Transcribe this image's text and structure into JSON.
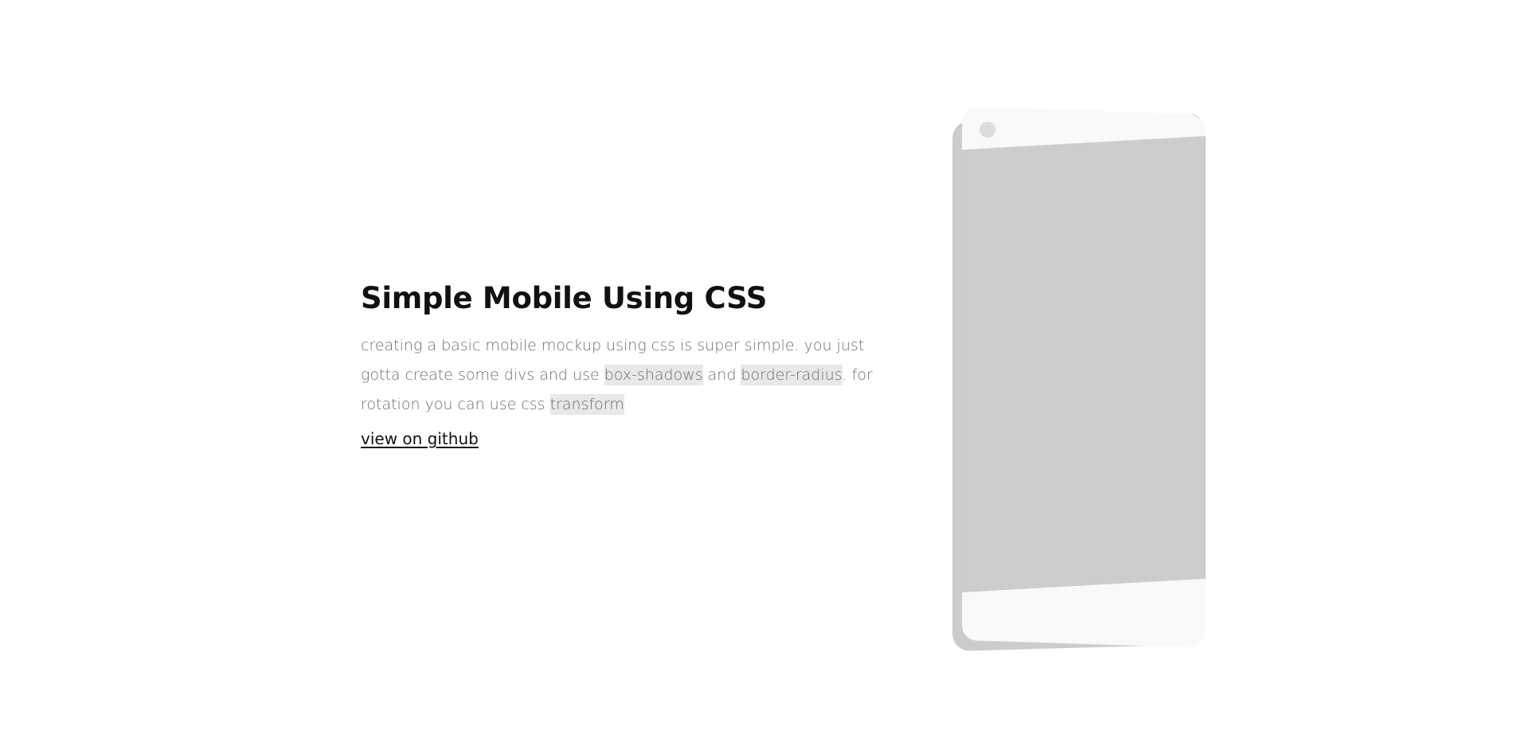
{
  "hero": {
    "title": "Simple Mobile Using CSS",
    "desc_part1": "creating a basic mobile mockup using css is super simple. you just",
    "desc_part2": "gotta create some divs and use ",
    "code1": "box-shadows",
    "desc_part3": " and ",
    "code2": "border-radius",
    "desc_part4": ". for",
    "desc_part5": "rotation you can use css ",
    "code3": "transform",
    "link_label": "view on github"
  },
  "colors": {
    "background": "#ffffff",
    "phone_body": "#f9f9f9",
    "phone_screen": "#cdcdcd",
    "phone_shadow": "#cccccc",
    "code_highlight": "#e8e8e8"
  }
}
